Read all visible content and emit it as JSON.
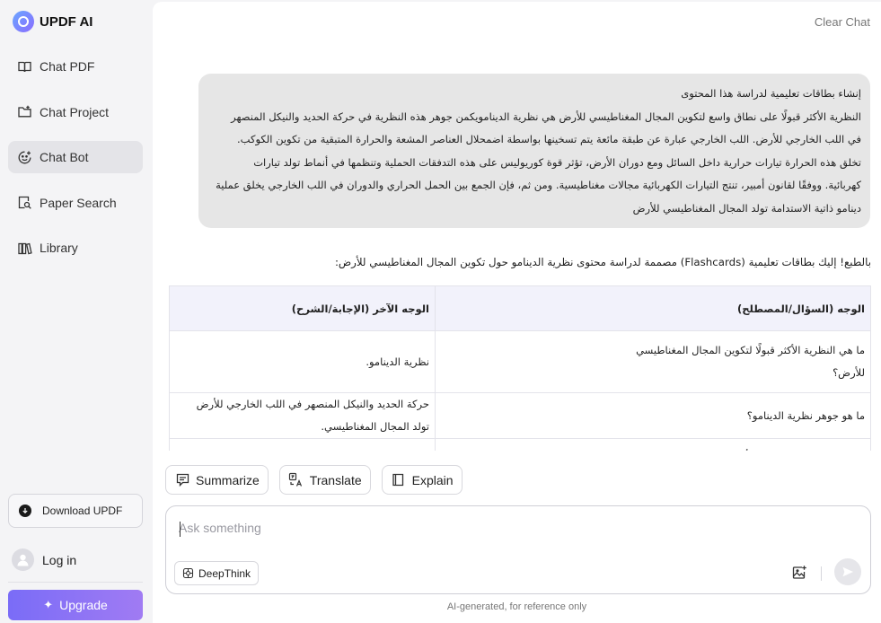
{
  "brand": {
    "name": "UPDF AI"
  },
  "sidebar": {
    "items": [
      {
        "label": "Chat PDF",
        "icon": "book-icon",
        "active": false
      },
      {
        "label": "Chat Project",
        "icon": "folder-icon",
        "active": false
      },
      {
        "label": "Chat Bot",
        "icon": "bot-icon",
        "active": true
      },
      {
        "label": "Paper Search",
        "icon": "paper-search-icon",
        "active": false
      },
      {
        "label": "Library",
        "icon": "library-icon",
        "active": false
      }
    ],
    "download_label": "Download UPDF",
    "login_label": "Log in",
    "upgrade_label": "Upgrade"
  },
  "header": {
    "clear_chat": "Clear Chat"
  },
  "chat": {
    "user_message_lines": [
      "إنشاء بطاقات تعليمية لدراسة هذا المحتوى",
      "النظرية الأكثر قبولًا على نطاق واسع لتكوين المجال المغناطيسي للأرض هي نظرية الدينامويكمن جوهر هذه النظرية في حركة الحديد والنيكل المنصهر",
      "في اللب الخارجي للأرض. اللب الخارجي عبارة عن طبقة مائعة يتم تسخينها بواسطة اضمحلال العناصر المشعة والحرارة المتبقية من تكوين الكوكب.",
      "تخلق هذه الحرارة تيارات حرارية داخل السائل ومع دوران الأرض، تؤثر قوة كوريوليس على هذه التدفقات الحملية وتنظمها في أنماط تولد تيارات",
      "كهربائية. ووفقًا لقانون أمبير، تنتج التيارات الكهربائية مجالات مغناطيسية. ومن ثم، فإن الجمع بين الحمل الحراري والدوران في اللب الخارجي يخلق عملية",
      "دينامو ذاتية الاستدامة تولد المجال المغناطيسي للأرض"
    ],
    "answer_intro": "بالطبع! إليك بطاقات تعليمية (Flashcards) مصممة لدراسة محتوى نظرية الدينامو حول تكوين المجال المغناطيسي للأرض:",
    "table": {
      "headers": [
        "الوجه (السؤال/المصطلح)",
        "الوجه الآخر (الإجابة/الشرح)"
      ],
      "rows": [
        {
          "front_lines": [
            "ما هي النظرية الأكثر قبولًا لتكوين المجال المغناطيسي",
            "للأرض؟"
          ],
          "back": "نظرية الدينامو."
        },
        {
          "front_lines": [
            "ما هو جوهر نظرية الدينامو؟"
          ],
          "back": "حركة الحديد والنيكل المنصهر في اللب الخارجي للأرض تولد المجال المغناطيسي."
        },
        {
          "front_lines": [
            "ماذا يتكون اللب الخارجي للأرض؟"
          ],
          "back": "يتكون من الحديد والنيكل المنصهر ويعتبر طبقة مائعة."
        }
      ]
    }
  },
  "actions": {
    "summarize": "Summarize",
    "translate": "Translate",
    "explain": "Explain"
  },
  "composer": {
    "placeholder": "Ask something",
    "deepthink_label": "DeepThink"
  },
  "footer": {
    "disclaimer": "AI-generated, for reference only"
  },
  "colors": {
    "accent": "#8a72f6",
    "active_nav": "#e4e4e8",
    "table_header": "#f2f2fb",
    "user_bubble": "#e6e6e6"
  }
}
